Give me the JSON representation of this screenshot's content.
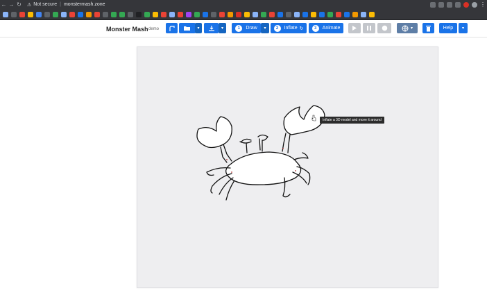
{
  "browser": {
    "not_secure": "Not secure",
    "url": "monstermash.zone",
    "bookmark_colors": [
      "#8ab4f8",
      "#5f6368",
      "#ea4335",
      "#fbbc04",
      "#4285f4",
      "#5f6368",
      "#34a853",
      "#8ab4f8",
      "#ea4335",
      "#1a73e8",
      "#f29900",
      "#ea4335",
      "#5f6368",
      "#34a853",
      "#34a853",
      "#5f6368",
      "#202124",
      "#34a853",
      "#fbbc04",
      "#ea4335",
      "#8ab4f8",
      "#ea4335",
      "#a142f4",
      "#34a853",
      "#1a73e8",
      "#5f6368",
      "#ea4335",
      "#f29900",
      "#d93025",
      "#fbbc04",
      "#8ab4f8",
      "#34a853",
      "#ea4335",
      "#1a73e8",
      "#5f6368",
      "#8ab4f8",
      "#1a73e8",
      "#fbbc04",
      "#1a73e8",
      "#34a853",
      "#ea4335",
      "#1a73e8",
      "#f29900",
      "#8ab4f8",
      "#fbbc04"
    ]
  },
  "app": {
    "title": "Monster Mash",
    "demo": "demo",
    "draw": {
      "num": "1",
      "label": "Draw"
    },
    "inflate": {
      "num": "2",
      "label": "Inflate"
    },
    "animate": {
      "num": "3",
      "label": "Animate"
    },
    "help": "Help",
    "tooltip": "Inflate a 3D model and move it around"
  },
  "colors": {
    "accent": "#1a73e8",
    "canvas": "#eeeef0"
  }
}
